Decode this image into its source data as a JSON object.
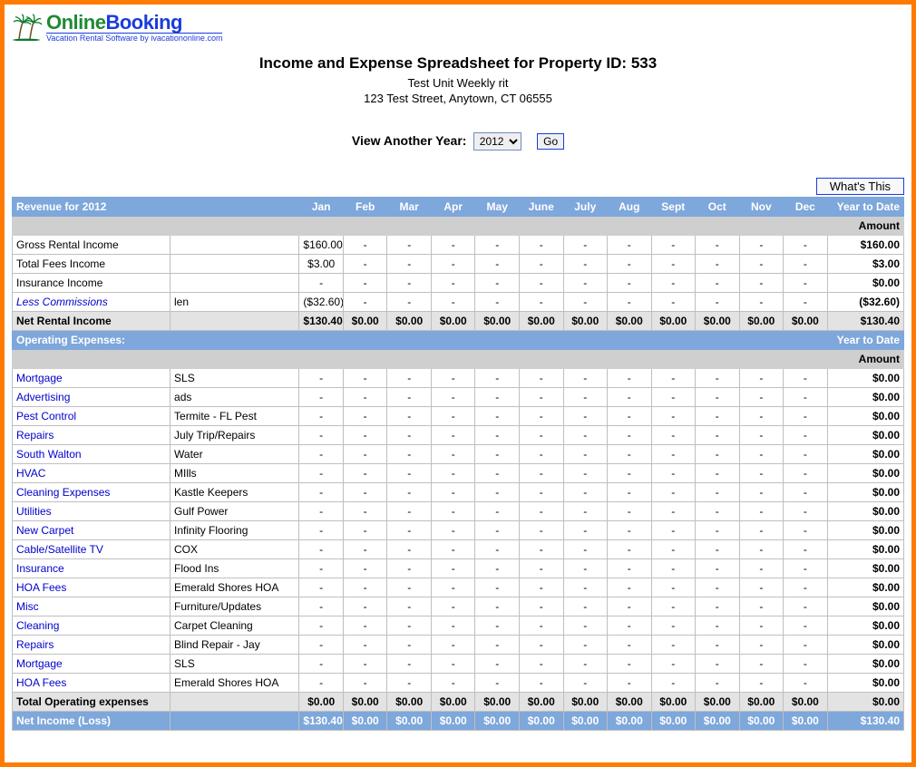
{
  "logo": {
    "brand_a": "Online",
    "brand_b": "Booking",
    "tagline": "Vacation Rental Software by ivacationonline.com"
  },
  "header": {
    "title": "Income and Expense Spreadsheet for Property ID: 533",
    "unit": "Test Unit Weekly rit",
    "address": "123 Test Street, Anytown, CT 06555"
  },
  "year_picker": {
    "label": "View Another Year:",
    "selected": "2012",
    "go_label": "Go"
  },
  "whats_this_label": "What's This",
  "months": [
    "Jan",
    "Feb",
    "Mar",
    "Apr",
    "May",
    "June",
    "July",
    "Aug",
    "Sept",
    "Oct",
    "Nov",
    "Dec"
  ],
  "ytd_label": "Year to Date",
  "amount_label": "Amount",
  "revenue": {
    "section_label": "Revenue for 2012",
    "rows": [
      {
        "label": "Gross Rental Income",
        "link": false,
        "note": "",
        "vals": [
          "$160.00",
          "-",
          "-",
          "-",
          "-",
          "-",
          "-",
          "-",
          "-",
          "-",
          "-",
          "-"
        ],
        "ytd": "$160.00"
      },
      {
        "label": "Total Fees Income",
        "link": false,
        "note": "",
        "vals": [
          "$3.00",
          "-",
          "-",
          "-",
          "-",
          "-",
          "-",
          "-",
          "-",
          "-",
          "-",
          "-"
        ],
        "ytd": "$3.00"
      },
      {
        "label": "Insurance Income",
        "link": false,
        "note": "",
        "vals": [
          "-",
          "-",
          "-",
          "-",
          "-",
          "-",
          "-",
          "-",
          "-",
          "-",
          "-",
          "-"
        ],
        "ytd": "$0.00"
      },
      {
        "label": "Less Commissions",
        "link": true,
        "italic": true,
        "note": "len",
        "vals": [
          "($32.60)",
          "-",
          "-",
          "-",
          "-",
          "-",
          "-",
          "-",
          "-",
          "-",
          "-",
          "-"
        ],
        "ytd": "($32.60)"
      }
    ],
    "net_label": "Net Rental Income",
    "net_vals": [
      "$130.40",
      "$0.00",
      "$0.00",
      "$0.00",
      "$0.00",
      "$0.00",
      "$0.00",
      "$0.00",
      "$0.00",
      "$0.00",
      "$0.00",
      "$0.00"
    ],
    "net_ytd": "$130.40"
  },
  "expenses": {
    "section_label": "Operating Expenses:",
    "rows": [
      {
        "label": "Mortgage",
        "note": "SLS",
        "ytd": "$0.00"
      },
      {
        "label": "Advertising",
        "note": "ads",
        "ytd": "$0.00"
      },
      {
        "label": "Pest Control",
        "note": "Termite - FL Pest",
        "ytd": "$0.00"
      },
      {
        "label": "Repairs",
        "note": "July Trip/Repairs",
        "ytd": "$0.00"
      },
      {
        "label": "South Walton",
        "note": "Water",
        "ytd": "$0.00"
      },
      {
        "label": "HVAC",
        "note": "MIlls",
        "ytd": "$0.00"
      },
      {
        "label": "Cleaning Expenses",
        "note": "Kastle Keepers",
        "ytd": "$0.00"
      },
      {
        "label": "Utilities",
        "note": "Gulf Power",
        "ytd": "$0.00"
      },
      {
        "label": "New Carpet",
        "note": "Infinity Flooring",
        "ytd": "$0.00"
      },
      {
        "label": "Cable/Satellite TV",
        "note": "COX",
        "ytd": "$0.00"
      },
      {
        "label": "Insurance",
        "note": "Flood Ins",
        "ytd": "$0.00"
      },
      {
        "label": "HOA Fees",
        "note": "Emerald Shores HOA",
        "ytd": "$0.00"
      },
      {
        "label": "Misc",
        "note": "Furniture/Updates",
        "ytd": "$0.00"
      },
      {
        "label": "Cleaning",
        "note": "Carpet Cleaning",
        "ytd": "$0.00"
      },
      {
        "label": "Repairs",
        "note": "Blind Repair - Jay",
        "ytd": "$0.00"
      },
      {
        "label": "Mortgage",
        "note": "SLS",
        "ytd": "$0.00"
      },
      {
        "label": "HOA Fees",
        "note": "Emerald Shores HOA",
        "ytd": "$0.00"
      }
    ],
    "total_label": "Total Operating expenses",
    "total_vals": [
      "$0.00",
      "$0.00",
      "$0.00",
      "$0.00",
      "$0.00",
      "$0.00",
      "$0.00",
      "$0.00",
      "$0.00",
      "$0.00",
      "$0.00",
      "$0.00"
    ],
    "total_ytd": "$0.00"
  },
  "net_income": {
    "label": "Net Income (Loss)",
    "vals": [
      "$130.40",
      "$0.00",
      "$0.00",
      "$0.00",
      "$0.00",
      "$0.00",
      "$0.00",
      "$0.00",
      "$0.00",
      "$0.00",
      "$0.00",
      "$0.00"
    ],
    "ytd": "$130.40"
  }
}
